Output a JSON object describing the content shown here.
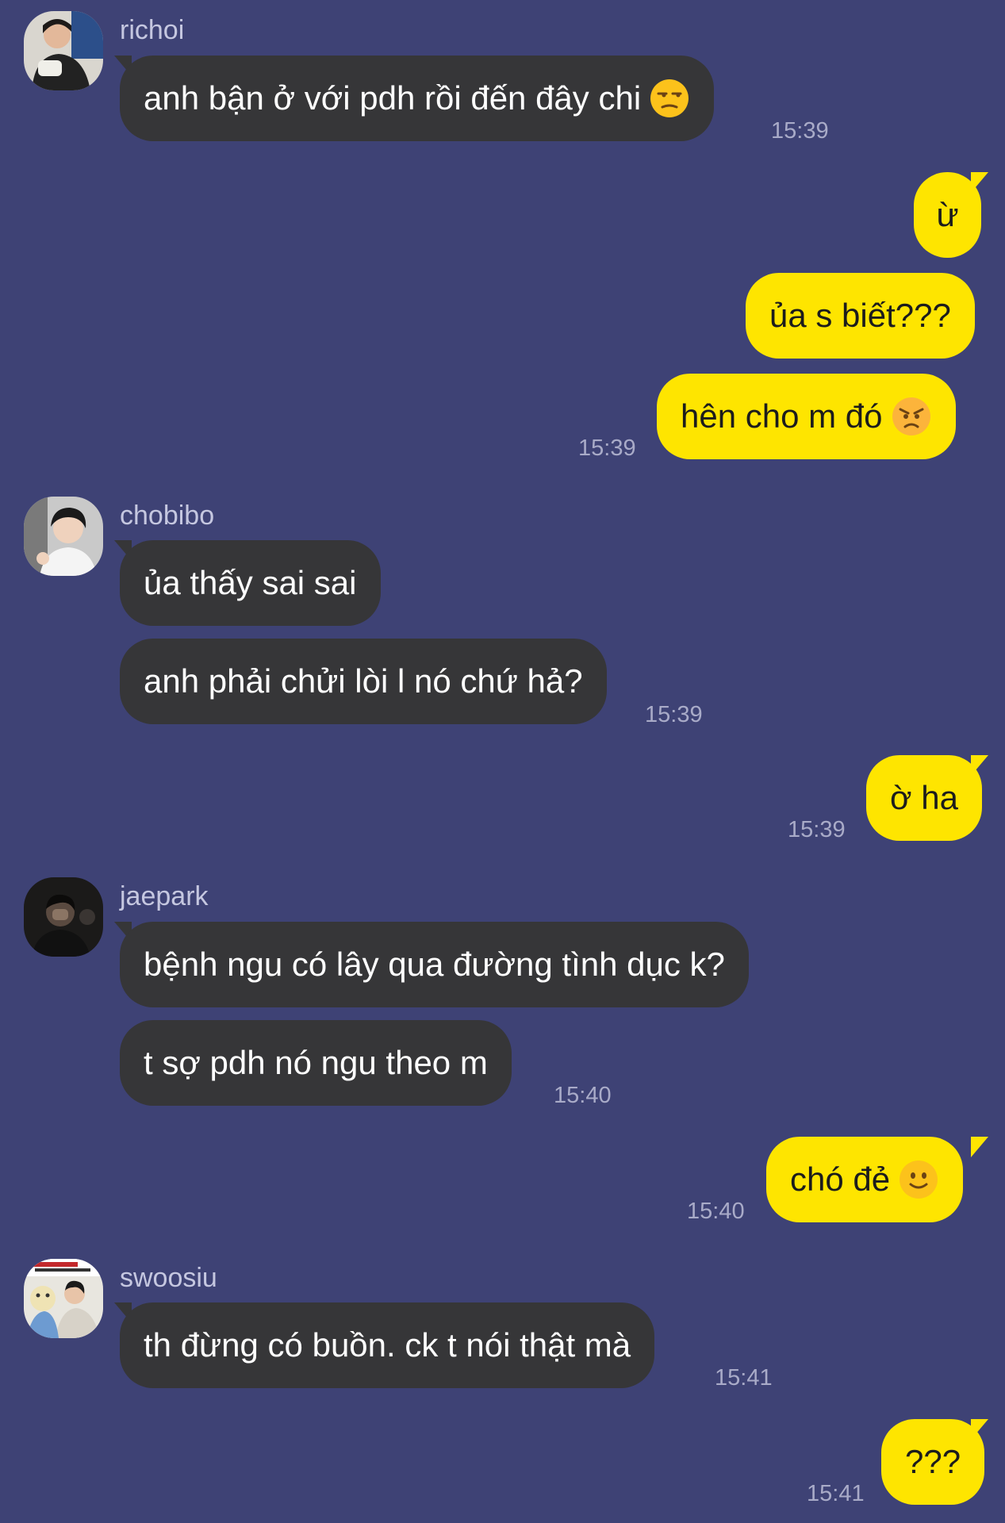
{
  "theme": {
    "background": "#3e4275",
    "incoming_bubble": "#363638",
    "outgoing_bubble": "#fee500"
  },
  "messages": {
    "m1": {
      "sender": "richoi",
      "text": "anh bận ở với pdh rồi đến đây chi",
      "emoji": "unamused-face-icon",
      "time": "15:39"
    },
    "m2": {
      "text": "ừ"
    },
    "m3": {
      "text": "ủa s biết???"
    },
    "m4": {
      "text": "hên cho m đó",
      "emoji": "angry-face-icon",
      "time": "15:39"
    },
    "m5": {
      "sender": "chobibo",
      "text": "ủa thấy sai sai"
    },
    "m6": {
      "text": "anh phải chửi lòi l nó chứ hả?",
      "time": "15:39"
    },
    "m7": {
      "text": "ờ ha",
      "time": "15:39"
    },
    "m8": {
      "sender": "jaepark",
      "text": "bệnh ngu có lây qua đường tình dục k?"
    },
    "m9": {
      "text": "t sợ pdh nó ngu theo m",
      "time": "15:40"
    },
    "m10": {
      "text": "chó đẻ",
      "emoji": "slightly-smiling-face-icon",
      "time": "15:40"
    },
    "m11": {
      "sender": "swoosiu",
      "text": "th đừng có buồn. ck t nói thật mà",
      "time": "15:41"
    },
    "m12": {
      "text": "???",
      "time": "15:41"
    }
  }
}
